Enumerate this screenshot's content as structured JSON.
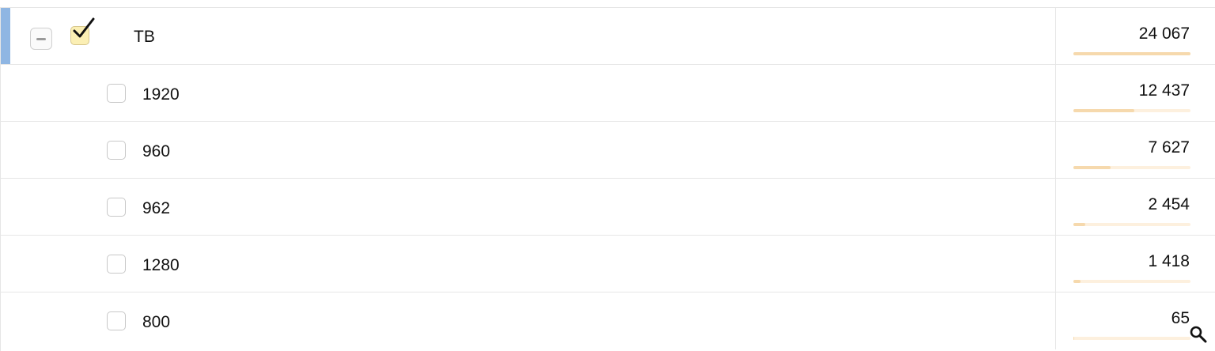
{
  "table": {
    "rows": [
      {
        "label": "TB",
        "value": "24 067",
        "fraction": 1.0,
        "checked": true,
        "level": 0,
        "expanded": true,
        "selected": true
      },
      {
        "label": "1920",
        "value": "12 437",
        "fraction": 0.517,
        "checked": false,
        "level": 1
      },
      {
        "label": "960",
        "value": "7 627",
        "fraction": 0.317,
        "checked": false,
        "level": 1
      },
      {
        "label": "962",
        "value": "2 454",
        "fraction": 0.102,
        "checked": false,
        "level": 1
      },
      {
        "label": "1280",
        "value": "1 418",
        "fraction": 0.059,
        "checked": false,
        "level": 1
      },
      {
        "label": "800",
        "value": "65",
        "fraction": 0.003,
        "checked": false,
        "level": 1
      }
    ]
  },
  "icons": {
    "collapse": "minus-icon",
    "check": "checkmark-icon",
    "search": "search-icon"
  },
  "colors": {
    "selection": "#8fb6e3",
    "checkbox_checked": "#fbefb4",
    "bar_track": "#fdf0de",
    "bar_fill": "#f6d9ad"
  }
}
